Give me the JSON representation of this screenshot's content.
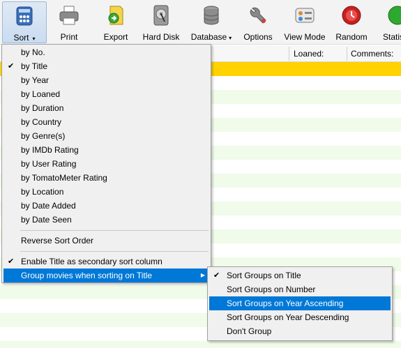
{
  "toolbar": {
    "buttons": [
      {
        "label": "Sort",
        "icon": "film-reel-sort-icon",
        "has_dropdown": true,
        "active": true
      },
      {
        "label": "Print",
        "icon": "printer-icon"
      },
      {
        "label": "Export",
        "icon": "export-icon"
      },
      {
        "label": "Hard Disk",
        "icon": "hard-disk-icon"
      },
      {
        "label": "Database",
        "icon": "database-icon",
        "has_dropdown": true
      },
      {
        "label": "Options",
        "icon": "wrench-icon"
      },
      {
        "label": "View Mode",
        "icon": "view-mode-icon"
      },
      {
        "label": "Random",
        "icon": "random-icon"
      },
      {
        "label": "Statis",
        "icon": "statistics-icon"
      }
    ],
    "dropdown_arrow": "▾"
  },
  "grid": {
    "columns": [
      "Loaned:",
      "Comments:"
    ],
    "colors": {
      "selected_row": "#ffd200",
      "alt_row": "#f0fbe9"
    }
  },
  "sort_menu": {
    "items": [
      {
        "label": "by No.",
        "checked": false
      },
      {
        "label": "by Title",
        "checked": true
      },
      {
        "label": "by Year",
        "checked": false
      },
      {
        "label": "by Loaned",
        "checked": false
      },
      {
        "label": "by Duration",
        "checked": false
      },
      {
        "label": "by Country",
        "checked": false
      },
      {
        "label": "by Genre(s)",
        "checked": false
      },
      {
        "label": "by IMDb Rating",
        "checked": false
      },
      {
        "label": "by User Rating",
        "checked": false
      },
      {
        "label": "by TomatoMeter Rating",
        "checked": false
      },
      {
        "label": "by Location",
        "checked": false
      },
      {
        "label": "by Date Added",
        "checked": false
      },
      {
        "label": "by Date Seen",
        "checked": false
      }
    ],
    "reverse": "Reverse Sort Order",
    "secondary": {
      "label": "Enable Title as secondary sort column",
      "checked": true
    },
    "group": {
      "label": "Group movies when sorting on Title",
      "highlighted": true
    }
  },
  "group_submenu": {
    "items": [
      {
        "label": "Sort Groups on Title",
        "checked": true,
        "highlighted": false
      },
      {
        "label": "Sort Groups on Number",
        "checked": false,
        "highlighted": false
      },
      {
        "label": "Sort Groups on Year Ascending",
        "checked": false,
        "highlighted": true
      },
      {
        "label": "Sort Groups on Year Descending",
        "checked": false,
        "highlighted": false
      },
      {
        "label": "Don't Group",
        "checked": false,
        "highlighted": false
      }
    ]
  },
  "glyphs": {
    "check": "✔",
    "submenu_arrow": "▶"
  },
  "colors": {
    "highlight": "#0078d7",
    "menu_bg": "#f0f0f0"
  }
}
